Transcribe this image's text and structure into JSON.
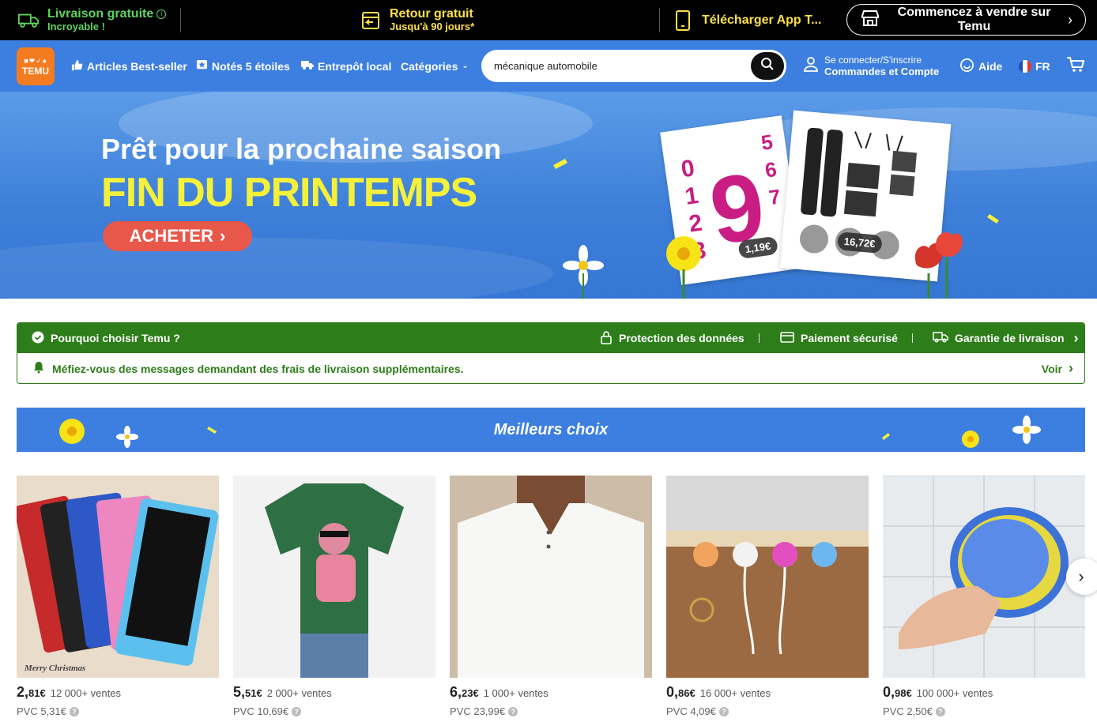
{
  "promo": {
    "shipping_title": "Livraison gratuite",
    "shipping_sub": "Incroyable !",
    "return_title": "Retour gratuit",
    "return_sub": "Jusqu'à 90 jours*",
    "app_title": "Télécharger App T...",
    "sell_label": "Commencez à vendre sur Temu"
  },
  "header": {
    "logo_text": "TEMU",
    "nav": [
      "Articles Best-seller",
      "Notés 5 étoiles",
      "Entrepôt local",
      "Catégories"
    ],
    "search_value": "mécanique automobile",
    "account_line1": "Se connecter/S'inscrire",
    "account_line2": "Commandes et Compte",
    "help": "Aide",
    "language": "FR"
  },
  "hero": {
    "subtitle": "Prêt pour la prochaine saison",
    "title": "FIN DU PRINTEMPS",
    "button": "ACHETER",
    "price_a": "1,19€",
    "price_b": "16,72€"
  },
  "trust": {
    "why": "Pourquoi choisir Temu ?",
    "data_protection": "Protection des données",
    "secure_payment": "Paiement sécurisé",
    "delivery_guarantee": "Garantie de livraison",
    "warning": "Méfiez-vous des messages demandant des frais de livraison supplémentaires.",
    "view": "Voir"
  },
  "section": {
    "title": "Meilleurs choix"
  },
  "products": [
    {
      "price_int": "2,",
      "price_dec": "81€",
      "sales": "12 000+ ventes",
      "rrp": "PVC 5,31€"
    },
    {
      "price_int": "5,",
      "price_dec": "51€",
      "sales": "2 000+ ventes",
      "rrp": "PVC 10,69€"
    },
    {
      "price_int": "6,",
      "price_dec": "23€",
      "sales": "1 000+ ventes",
      "rrp": "PVC 23,99€"
    },
    {
      "price_int": "0,",
      "price_dec": "86€",
      "sales": "16 000+ ventes",
      "rrp": "PVC 4,09€"
    },
    {
      "price_int": "0,",
      "price_dec": "98€",
      "sales": "100 000+ ventes",
      "rrp": "PVC 2,50€"
    }
  ],
  "colors": {
    "header_blue": "#3d7fe0",
    "promo_yellow": "#fbe04b",
    "trust_green": "#2d7d1a",
    "hero_button": "#e8584a",
    "hero_title": "#f5f03a",
    "logo_orange": "#f47c20"
  }
}
